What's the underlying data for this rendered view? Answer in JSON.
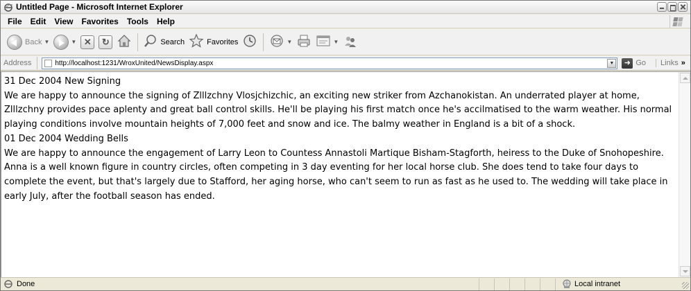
{
  "window": {
    "title": "Untitled Page - Microsoft Internet Explorer"
  },
  "menubar": {
    "items": [
      "File",
      "Edit",
      "View",
      "Favorites",
      "Tools",
      "Help"
    ]
  },
  "toolbar": {
    "back_label": "Back",
    "search_label": "Search",
    "favorites_label": "Favorites"
  },
  "addressbar": {
    "label": "Address",
    "url": "http://localhost:1231/WroxUnited/NewsDisplay.aspx",
    "go_label": "Go",
    "links_label": "Links"
  },
  "news": [
    {
      "heading": "31 Dec 2004 New Signing",
      "body": "We are happy to announce the signing of Zlllzchny Vlosjchizchic, an exciting new striker from Azchanokistan. An underrated player at home, Zlllzchny provides pace aplenty and great ball control skills. He'll be playing his first match once he's accilmatised to the warm weather. His normal playing conditions involve mountain heights of 7,000 feet and snow and ice. The balmy weather in England is a bit of a shock."
    },
    {
      "heading": "01 Dec 2004 Wedding Bells",
      "body": "We are happy to announce the engagement of Larry Leon to Countess Annastoli Martique Bisham-Stagforth, heiress to the Duke of Snohopeshire. Anna is a well known figure in country circles, often competing in 3 day eventing for her local horse club. She does tend to take four days to complete the event, but that's largely due to Stafford, her aging horse, who can't seem to run as fast as he used to. The wedding will take place in early July, after the football season has ended."
    }
  ],
  "statusbar": {
    "status_text": "Done",
    "zone_text": "Local intranet"
  }
}
